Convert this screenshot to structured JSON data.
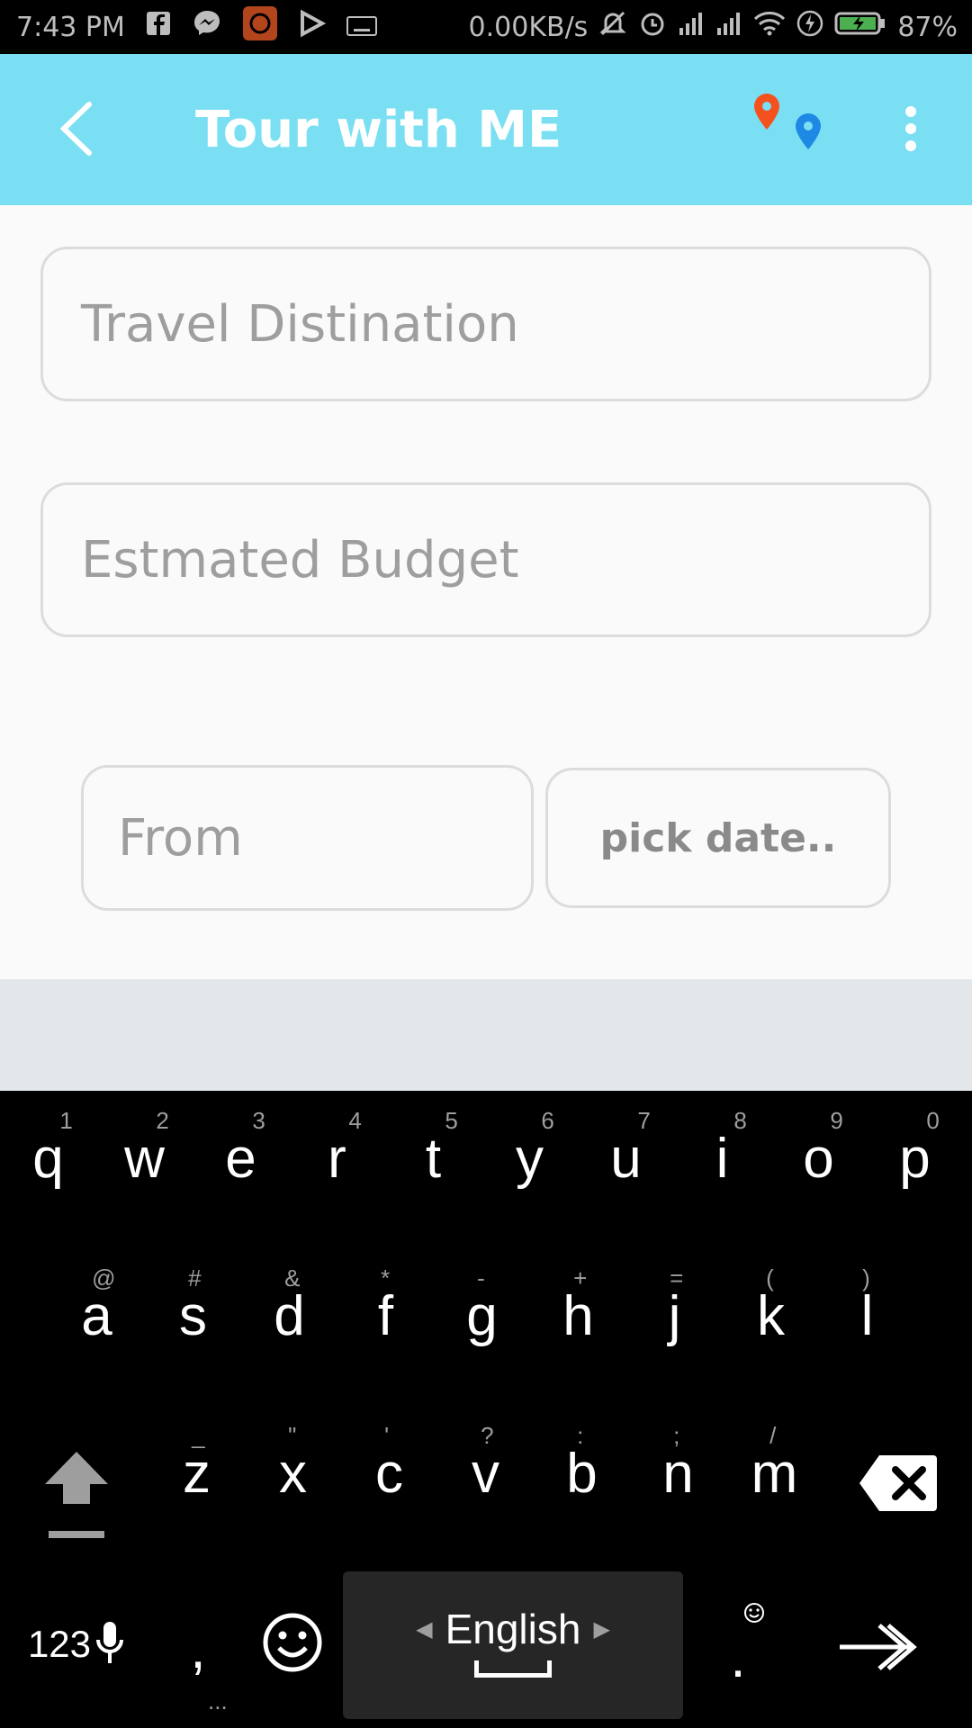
{
  "status_bar": {
    "time": "7:43 PM",
    "network_speed": "0.00KB/s",
    "battery": "87%",
    "icons": [
      "facebook-icon",
      "messenger-icon",
      "mi-app-icon",
      "play-icon",
      "keyboard-icon",
      "mute-icon",
      "alarm-icon",
      "signal-icon",
      "signal-icon",
      "wifi-icon",
      "flash-icon",
      "battery-charging-icon"
    ]
  },
  "app_bar": {
    "title": "Tour with ME",
    "background": "#7adff2",
    "icons": [
      "back-arrow-icon",
      "map-pins-icon",
      "more-vert-icon"
    ]
  },
  "form": {
    "destination_placeholder": "Travel Distination",
    "budget_placeholder": "Estmated Budget",
    "from_placeholder": "From",
    "pick_date_label": "pick date.."
  },
  "keyboard": {
    "row1": [
      {
        "k": "q",
        "h": "1"
      },
      {
        "k": "w",
        "h": "2"
      },
      {
        "k": "e",
        "h": "3"
      },
      {
        "k": "r",
        "h": "4"
      },
      {
        "k": "t",
        "h": "5"
      },
      {
        "k": "y",
        "h": "6"
      },
      {
        "k": "u",
        "h": "7"
      },
      {
        "k": "i",
        "h": "8"
      },
      {
        "k": "o",
        "h": "9"
      },
      {
        "k": "p",
        "h": "0"
      }
    ],
    "row2": [
      {
        "k": "a",
        "h": "@"
      },
      {
        "k": "s",
        "h": "#"
      },
      {
        "k": "d",
        "h": "&"
      },
      {
        "k": "f",
        "h": "*"
      },
      {
        "k": "g",
        "h": "-"
      },
      {
        "k": "h",
        "h": "+"
      },
      {
        "k": "j",
        "h": "="
      },
      {
        "k": "k",
        "h": "("
      },
      {
        "k": "l",
        "h": ")"
      }
    ],
    "row3": [
      {
        "k": "z",
        "h": "_"
      },
      {
        "k": "x",
        "h": "\""
      },
      {
        "k": "c",
        "h": "'"
      },
      {
        "k": "v",
        "h": "?"
      },
      {
        "k": "b",
        "h": ":"
      },
      {
        "k": "n",
        "h": ";"
      },
      {
        "k": "m",
        "h": "/"
      }
    ],
    "symbols_label": "123",
    "comma": ",",
    "comma_hint": "...",
    "period": ".",
    "language": "English"
  }
}
